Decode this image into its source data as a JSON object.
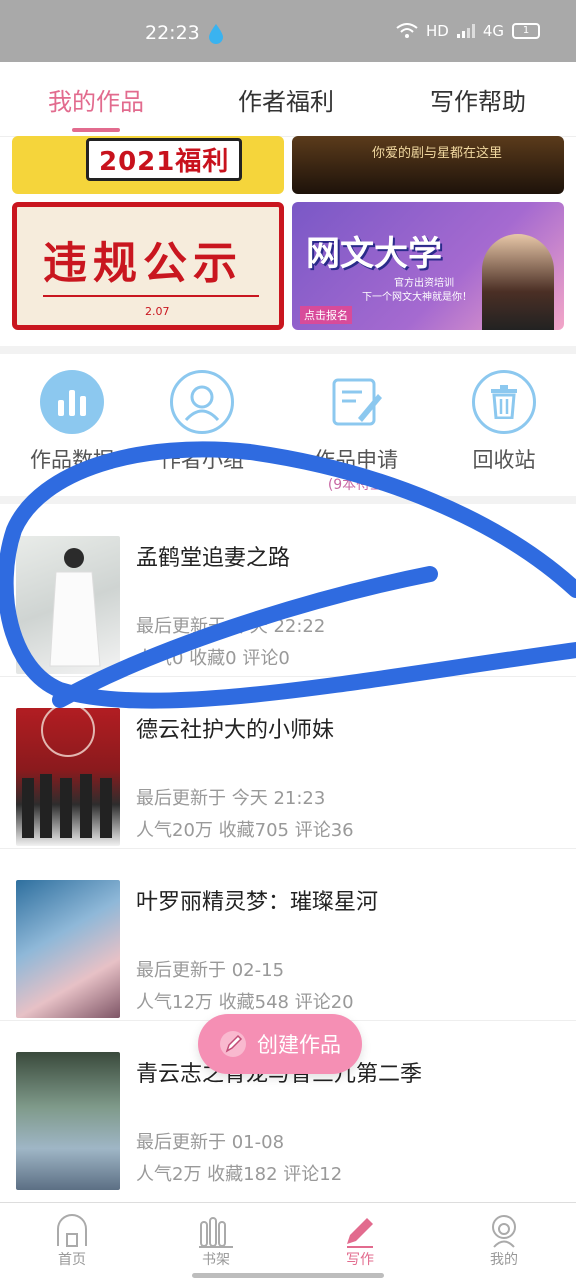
{
  "status_bar": {
    "time": "22:23",
    "network": "HD",
    "signal": "4G",
    "battery": "1"
  },
  "tabs": [
    {
      "label": "我的作品",
      "active": true
    },
    {
      "label": "作者福利",
      "active": false
    },
    {
      "label": "写作帮助",
      "active": false
    }
  ],
  "banners": {
    "welfare": "2021福利",
    "drama": "你爱的剧与星都在这里",
    "violation_title": "违规公示",
    "violation_date": "2.07",
    "university_title": "网文大学",
    "university_sub1": "官方出资培训",
    "university_sub2": "下一个网文大神就是你！",
    "university_cta": "点击报名"
  },
  "tools": [
    {
      "label": "作品数据",
      "icon": "bar-chart-icon"
    },
    {
      "label": "作者小组",
      "icon": "author-group-icon"
    },
    {
      "label": "作品申请",
      "sub": "(9本待上",
      "icon": "edit-form-icon"
    },
    {
      "label": "回收站",
      "icon": "trash-icon"
    }
  ],
  "works": [
    {
      "title": "孟鹤堂追妻之路",
      "updated": "最后更新于 今天 22:22",
      "stats": "人气0 收藏0 评论0"
    },
    {
      "title": "德云社护大的小师妹",
      "updated": "最后更新于 今天 21:23",
      "stats": "人气20万 收藏705 评论36"
    },
    {
      "title": "叶罗丽精灵梦：璀璨星河",
      "updated": "最后更新于 02-15",
      "stats": "人气12万 收藏548 评论20"
    },
    {
      "title": "青云志之青龙与曾三儿第二季",
      "updated": "最后更新于 01-08",
      "stats": "人气2万 收藏182 评论12"
    }
  ],
  "create_button": "创建作品",
  "bottom_nav": [
    {
      "label": "首页",
      "icon": "home-icon",
      "active": false
    },
    {
      "label": "书架",
      "icon": "bookshelf-icon",
      "active": false
    },
    {
      "label": "写作",
      "icon": "pen-icon",
      "active": true
    },
    {
      "label": "我的",
      "icon": "profile-icon",
      "active": false
    }
  ],
  "colors": {
    "accent": "#e26b8e",
    "button": "#f58fb4",
    "marker": "#2f6be0"
  }
}
